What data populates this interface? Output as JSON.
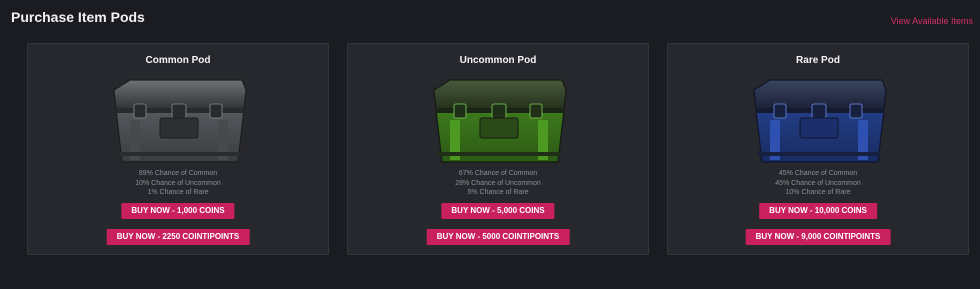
{
  "header": {
    "title": "Purchase Item Pods",
    "view_link": "View Available Items"
  },
  "pods": [
    {
      "name": "Common Pod",
      "color": "#5a5d62",
      "icon": "common-pod-crate-icon",
      "odds": [
        "89% Chance of Common",
        "10% Chance of Uncommon",
        "1% Chance of Rare"
      ],
      "buy_coins": "BUY NOW - 1,000 COINS",
      "buy_cointipoints": "BUY NOW - 2250 COINTIPOINTS"
    },
    {
      "name": "Uncommon Pod",
      "color": "#3f8a1a",
      "icon": "uncommon-pod-crate-icon",
      "odds": [
        "67% Chance of Common",
        "28% Chance of Uncommon",
        "5% Chance of Rare"
      ],
      "buy_coins": "BUY NOW - 5,000 COINS",
      "buy_cointipoints": "BUY NOW - 5000 COINTIPOINTS"
    },
    {
      "name": "Rare Pod",
      "color": "#1f3b8c",
      "icon": "rare-pod-crate-icon",
      "odds": [
        "45% Chance of Common",
        "45% Chance of Uncommon",
        "10% Chance of Rare"
      ],
      "buy_coins": "BUY NOW - 10,000 COINS",
      "buy_cointipoints": "BUY NOW - 9,000 COINTIPOINTS"
    }
  ],
  "colors": {
    "background": "#1b1c21",
    "card": "#26282d",
    "accent": "#c8215e",
    "link": "#d4306a"
  }
}
